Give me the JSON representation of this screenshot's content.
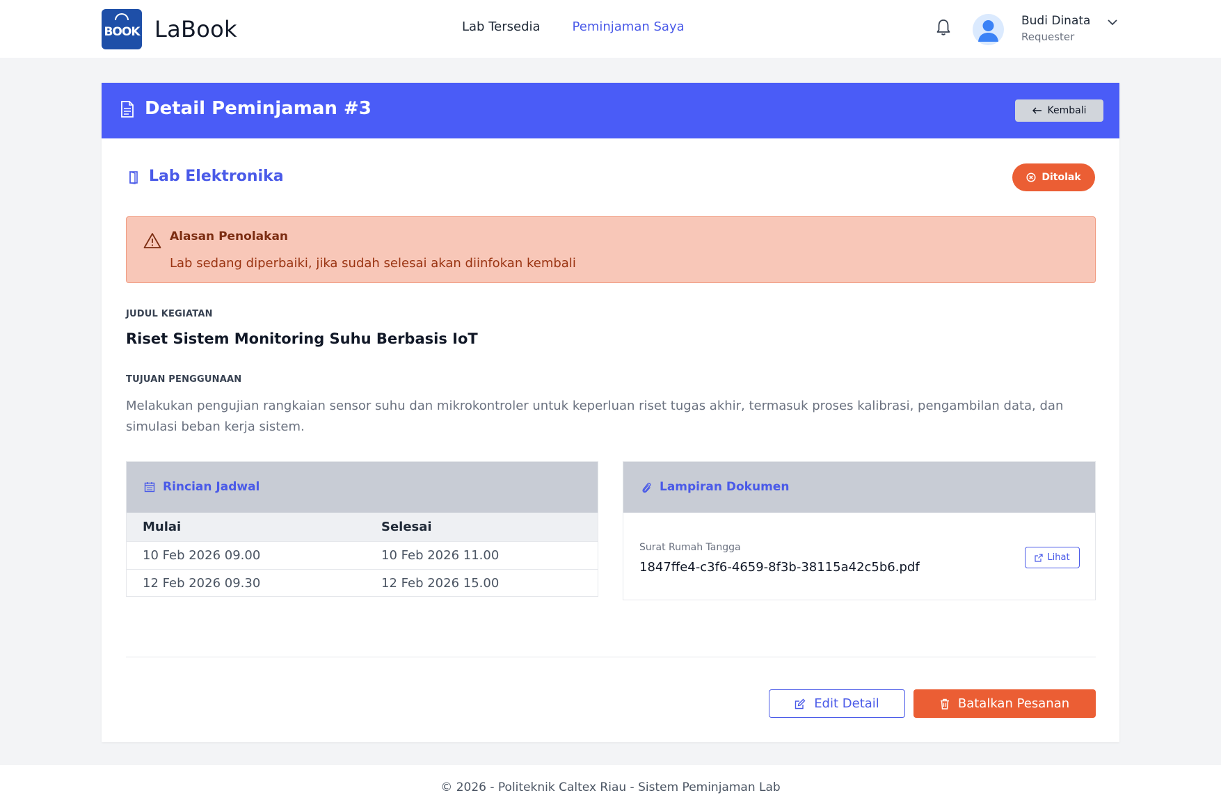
{
  "app": {
    "name": "LaBook",
    "logo_text": "BOOK"
  },
  "nav": {
    "items": [
      {
        "label": "Lab Tersedia",
        "active": false
      },
      {
        "label": "Peminjaman Saya",
        "active": true
      }
    ]
  },
  "user": {
    "name": "Budi Dinata",
    "role": "Requester"
  },
  "page": {
    "title": "Detail Peminjaman #3",
    "back_label": "Kembali"
  },
  "lab": {
    "name": "Lab Elektronika"
  },
  "status": {
    "label": "Ditolak",
    "color": "#eb5e34"
  },
  "rejection": {
    "title": "Alasan Penolakan",
    "reason": "Lab sedang diperbaiki, jika sudah selesai akan diinfokan kembali"
  },
  "activity": {
    "label": "JUDUL KEGIATAN",
    "title": "Riset Sistem Monitoring Suhu Berbasis IoT"
  },
  "purpose": {
    "label": "TUJUAN PENGGUNAAN",
    "text": "Melakukan pengujian rangkaian sensor suhu dan mikrokontroler untuk keperluan riset tugas akhir, termasuk proses kalibrasi, pengambilan data, dan simulasi beban kerja sistem."
  },
  "schedule": {
    "title": "Rincian Jadwal",
    "columns": [
      "Mulai",
      "Selesai"
    ],
    "rows": [
      [
        "10 Feb 2026 09.00",
        "10 Feb 2026 11.00"
      ],
      [
        "12 Feb 2026 09.30",
        "12 Feb 2026 15.00"
      ]
    ]
  },
  "attachments": {
    "title": "Lampiran Dokumen",
    "items": [
      {
        "label": "Surat Rumah Tangga",
        "filename": "1847ffe4-c3f6-4659-8f3b-38115a42c5b6.pdf",
        "action": "Lihat"
      }
    ]
  },
  "actions": {
    "edit_label": "Edit Detail",
    "cancel_label": "Batalkan Pesanan"
  },
  "footer": {
    "text": "© 2026 - Politeknik Caltex Riau - Sistem Peminjaman Lab"
  },
  "colors": {
    "primary": "#4a5cf7",
    "danger": "#eb5e34",
    "alert_bg": "#f8c7b8"
  }
}
